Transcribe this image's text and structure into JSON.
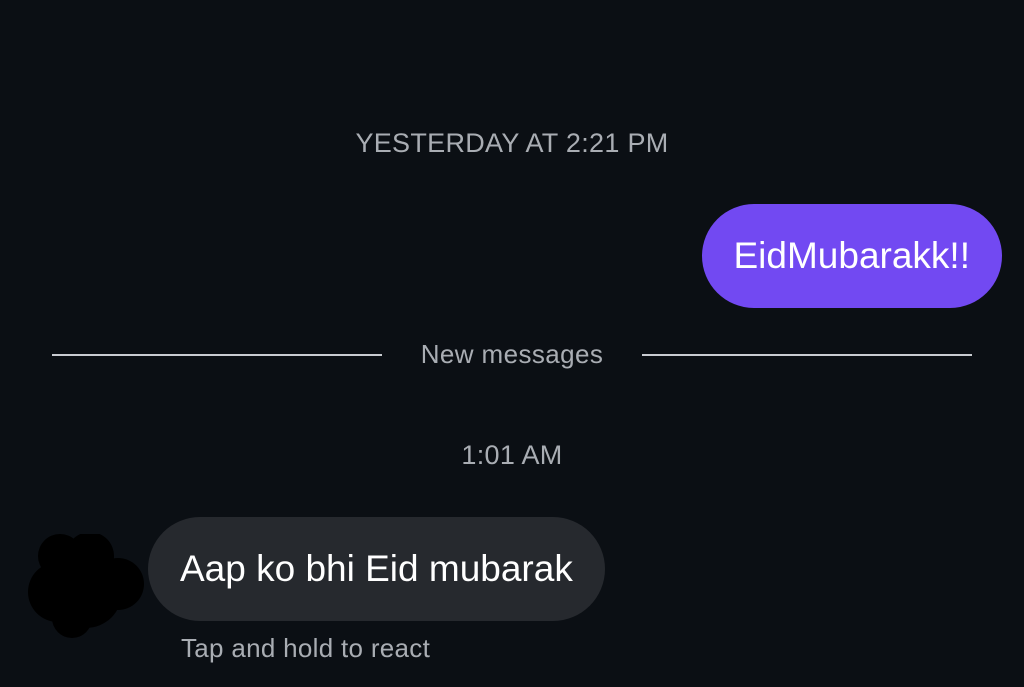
{
  "conversation": {
    "timestamp_1": "YESTERDAY AT 2:21 PM",
    "outgoing_message": "EidMubarakk!!",
    "new_messages_divider": "New messages",
    "timestamp_2": "1:01 AM",
    "incoming_message": "Aap ko bhi Eid mubarak",
    "reaction_hint": "Tap and hold to react"
  },
  "colors": {
    "background": "#0b0f14",
    "outgoing_bubble": "#7249f2",
    "incoming_bubble": "#26292e",
    "secondary_text": "#a9adb3",
    "avatar": "#000000"
  },
  "icons": {
    "avatar": "avatar-icon"
  }
}
